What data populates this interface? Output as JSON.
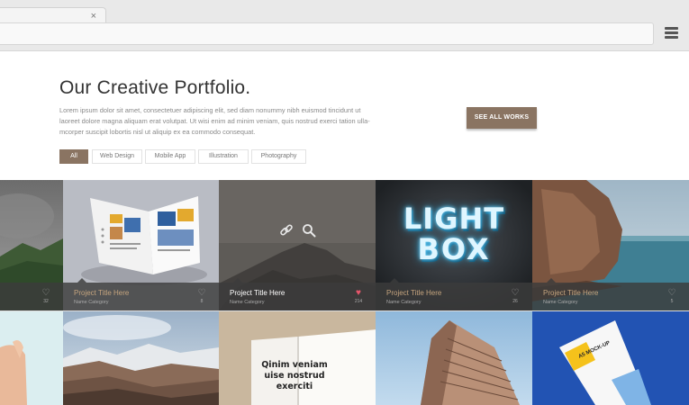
{
  "browser": {
    "tab_close": "×"
  },
  "hero": {
    "title": "Our Creative Portfolio.",
    "description": "Lorem ipsum dolor sit amet, consectetuer adipiscing elit, sed diam nonummy nibh euismod tincidunt ut laoreet dolore magna aliquam erat volutpat. Ut wisi enim ad minim veniam, quis nostrud exerci tation ulla-mcorper suscipit lobortis nisl ut aliquip ex ea commodo consequat.",
    "cta_label": "SEE ALL WORKS",
    "filters": [
      "All",
      "Web Design",
      "Mobile App",
      "Illustration",
      "Photography"
    ],
    "active_filter": "All"
  },
  "projects": [
    {
      "title": "",
      "category": "",
      "likes": "32",
      "heart_color": "grey"
    },
    {
      "title": "Project Title Here",
      "category": "Name Category",
      "likes": "8",
      "heart_color": "grey"
    },
    {
      "title": "Project Title Here",
      "category": "Name Category",
      "likes": "214",
      "heart_color": "red"
    },
    {
      "title": "Project Title Here",
      "category": "Name Category",
      "likes": "26",
      "heart_color": "grey"
    },
    {
      "title": "Project Title Here",
      "category": "Name Category",
      "likes": "5",
      "heart_color": "grey"
    }
  ],
  "tiles_text": {
    "lightbox_line1": "LIGHT",
    "lightbox_line2": "BOX",
    "book_text": "Qinim veniam uise nostrud exerciti",
    "mockup_label": "A5 MOCK-UP"
  },
  "colors": {
    "accent": "#8a7462",
    "title_gold": "#c5a47e",
    "heart_red": "#e8566b"
  },
  "icons": [
    "hamburger-menu-icon",
    "close-icon",
    "heart-icon",
    "link-icon",
    "search-icon"
  ]
}
